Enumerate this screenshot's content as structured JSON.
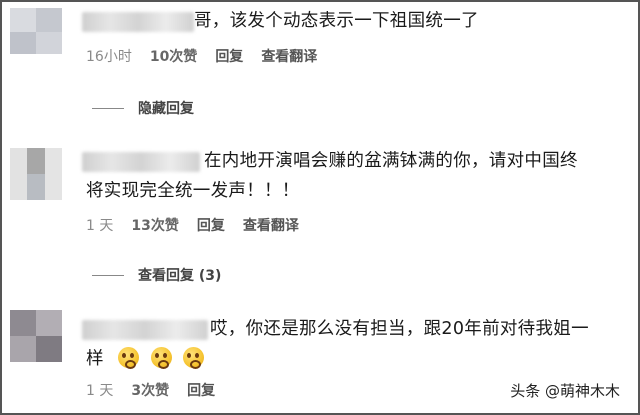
{
  "comments": [
    {
      "text": "哥，该发个动态表示一下祖国统一了",
      "time": "16小时",
      "likes": "10次赞",
      "reply_label": "回复",
      "translate_label": "查看翻译",
      "replies_toggle": "隐藏回复"
    },
    {
      "text_line1": "在内地开演唱会赚的盆满钵满的你，请对中国终",
      "text_line2": "将实现完全统一发声！！！",
      "time": "1 天",
      "likes": "13次赞",
      "reply_label": "回复",
      "translate_label": "查看翻译",
      "replies_toggle": "查看回复 (3)"
    },
    {
      "text_line1": "哎，你还是那么没有担当，跟20年前对待我姐一",
      "text_line2": "样",
      "emoji": "grimace-emoji",
      "time": "1 天",
      "likes": "3次赞",
      "reply_label": "回复"
    }
  ],
  "watermark": {
    "text": "头条 @萌神木木"
  }
}
